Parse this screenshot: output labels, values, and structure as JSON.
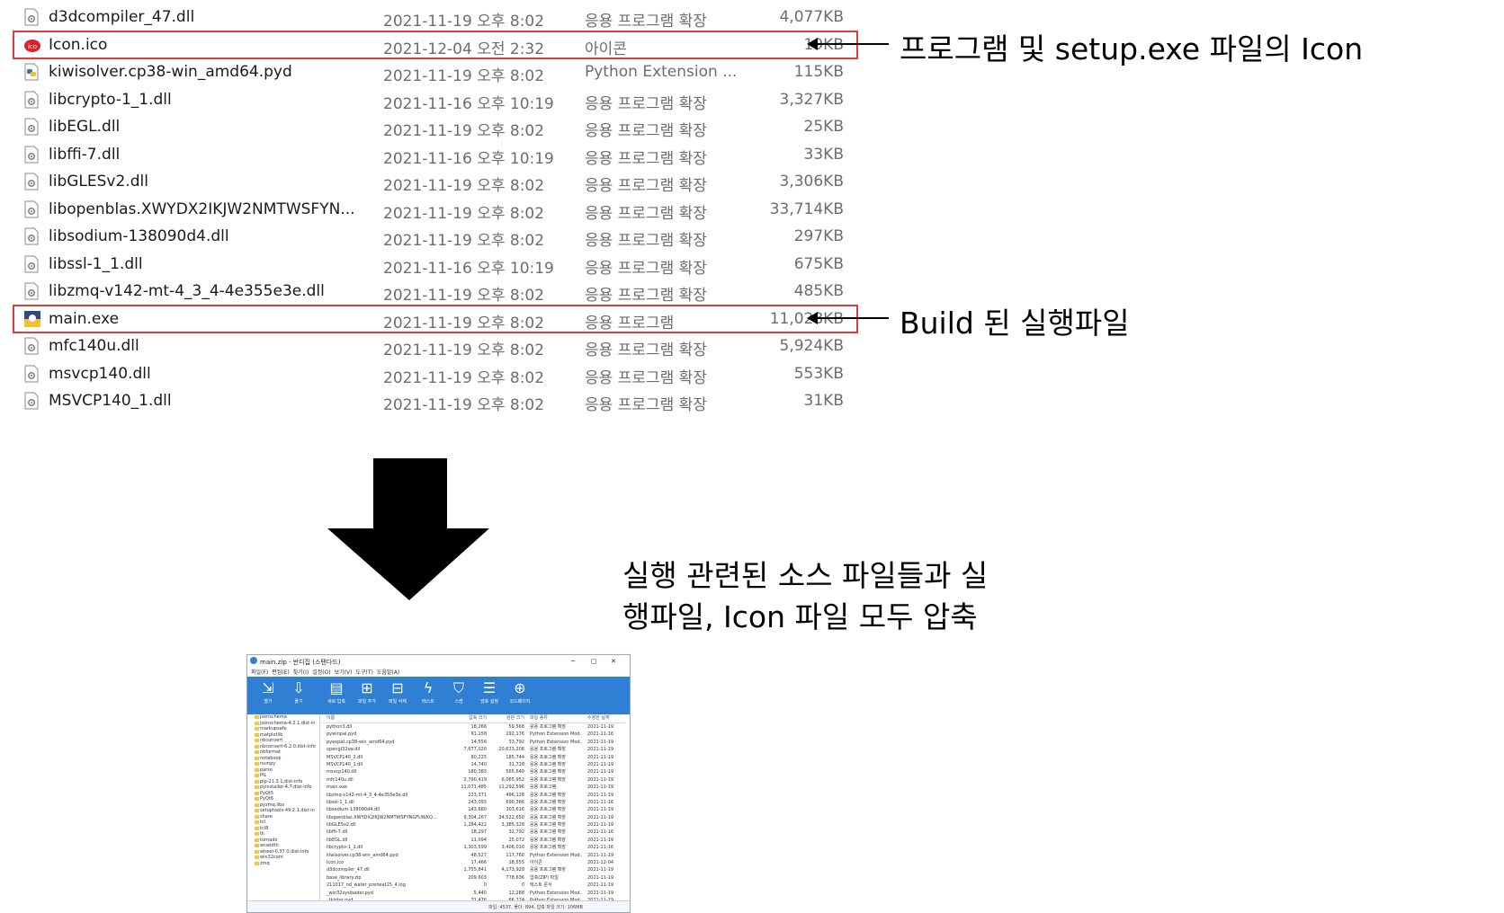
{
  "files": [
    {
      "name": "d3dcompiler_47.dll",
      "date": "2021-11-19 오후 8:02",
      "type": "응용 프로그램 확장",
      "size": "4,077KB",
      "icon": "dll-file-icon",
      "highlight": false
    },
    {
      "name": "Icon.ico",
      "date": "2021-12-04 오전 2:32",
      "type": "아이콘",
      "size": "19KB",
      "icon": "ico-file-icon",
      "highlight": true
    },
    {
      "name": "kiwisolver.cp38-win_amd64.pyd",
      "date": "2021-11-19 오후 8:02",
      "type": "Python Extension ...",
      "size": "115KB",
      "icon": "python-file-icon",
      "highlight": false
    },
    {
      "name": "libcrypto-1_1.dll",
      "date": "2021-11-16 오후 10:19",
      "type": "응용 프로그램 확장",
      "size": "3,327KB",
      "icon": "dll-file-icon",
      "highlight": false
    },
    {
      "name": "libEGL.dll",
      "date": "2021-11-19 오후 8:02",
      "type": "응용 프로그램 확장",
      "size": "25KB",
      "icon": "dll-file-icon",
      "highlight": false
    },
    {
      "name": "libffi-7.dll",
      "date": "2021-11-16 오후 10:19",
      "type": "응용 프로그램 확장",
      "size": "33KB",
      "icon": "dll-file-icon",
      "highlight": false
    },
    {
      "name": "libGLESv2.dll",
      "date": "2021-11-19 오후 8:02",
      "type": "응용 프로그램 확장",
      "size": "3,306KB",
      "icon": "dll-file-icon",
      "highlight": false
    },
    {
      "name": "libopenblas.XWYDX2IKJW2NMTWSFYN...",
      "date": "2021-11-19 오후 8:02",
      "type": "응용 프로그램 확장",
      "size": "33,714KB",
      "icon": "dll-file-icon",
      "highlight": false
    },
    {
      "name": "libsodium-138090d4.dll",
      "date": "2021-11-19 오후 8:02",
      "type": "응용 프로그램 확장",
      "size": "297KB",
      "icon": "dll-file-icon",
      "highlight": false
    },
    {
      "name": "libssl-1_1.dll",
      "date": "2021-11-16 오후 10:19",
      "type": "응용 프로그램 확장",
      "size": "675KB",
      "icon": "dll-file-icon",
      "highlight": false
    },
    {
      "name": "libzmq-v142-mt-4_3_4-4e355e3e.dll",
      "date": "2021-11-19 오후 8:02",
      "type": "응용 프로그램 확장",
      "size": "485KB",
      "icon": "dll-file-icon",
      "highlight": false
    },
    {
      "name": "main.exe",
      "date": "2021-11-19 오후 8:02",
      "type": "응용 프로그램",
      "size": "11,028KB",
      "icon": "exe-file-icon",
      "highlight": true
    },
    {
      "name": "mfc140u.dll",
      "date": "2021-11-19 오후 8:02",
      "type": "응용 프로그램 확장",
      "size": "5,924KB",
      "icon": "dll-file-icon",
      "highlight": false
    },
    {
      "name": "msvcp140.dll",
      "date": "2021-11-19 오후 8:02",
      "type": "응용 프로그램 확장",
      "size": "553KB",
      "icon": "dll-file-icon",
      "highlight": false
    },
    {
      "name": "MSVCP140_1.dll",
      "date": "2021-11-19 오후 8:02",
      "type": "응용 프로그램 확장",
      "size": "31KB",
      "icon": "dll-file-icon",
      "highlight": false
    }
  ],
  "annotations": {
    "icon_note": "프로그램 및 setup.exe 파일의 Icon",
    "build_note": "Build 된 실행파일",
    "zip_note_line1": "실행 관련된 소스 파일들과 실",
    "zip_note_line2": "행파일, Icon 파일 모두 압축"
  },
  "colors": {
    "highlight_border": "#e53a3a",
    "toolbar_bg": "#2f7fd4",
    "secondary_text": "#6d6d6d"
  },
  "mini_window": {
    "title": "main.zip - 반디집 (스탠다드)",
    "window_controls": [
      "─",
      "□",
      "✕"
    ],
    "menu": [
      "파일(F)",
      "편집(E)",
      "찾기(I)",
      "설정(O)",
      "보기(V)",
      "도구(T)",
      "도움말(A)"
    ],
    "toolbar": [
      {
        "label": "열기",
        "icon": "open-icon",
        "glyph": "⇲"
      },
      {
        "label": "풀기",
        "icon": "extract-icon",
        "glyph": "⇩"
      },
      {
        "label": "새로 압축",
        "icon": "new-archive-icon",
        "glyph": "▤"
      },
      {
        "label": "파일 추가",
        "icon": "add-file-icon",
        "glyph": "⊞"
      },
      {
        "label": "파일 삭제",
        "icon": "delete-file-icon",
        "glyph": "⊟"
      },
      {
        "label": "테스트",
        "icon": "test-icon",
        "glyph": "ϟ"
      },
      {
        "label": "스캔",
        "icon": "scan-icon",
        "glyph": "⛉"
      },
      {
        "label": "암호 설정",
        "icon": "password-icon",
        "glyph": "☰"
      },
      {
        "label": "코드페이지",
        "icon": "codepage-icon",
        "glyph": "⊕"
      }
    ],
    "folders": [
      "jsonschema",
      "jsonschema-4.2.1.dist-in",
      "markupsafe",
      "matplotlib",
      "nbconvert",
      "nbconvert-6.2.0.dist-info",
      "nbformat",
      "notebook",
      "numpy",
      "parso",
      "PIL",
      "pip-21.3.1.dist-info",
      "pyinstaller-4.7.dist-info",
      "PyQt5",
      "PyQt6",
      "pyzmq.libs",
      "setuptools-49.2.1.dist-in",
      "share",
      "tcl",
      "tcl8",
      "tk",
      "tornado",
      "wcwidth",
      "wheel-0.37.0.dist-info",
      "win32com",
      "zmq"
    ],
    "columns": [
      "이름",
      "압축 크기",
      "원본 크기",
      "파일 종류",
      "수정한 날짜"
    ],
    "rows": [
      [
        "python3.dll",
        "18,266",
        "59,568",
        "응용 프로그램 확장",
        "2021-11-19"
      ],
      [
        "pywinpal.pyd",
        "91,158",
        "192,176",
        "Python Extension Mod...",
        "2021-11-16"
      ],
      [
        "pyexpat.cp38-win_amd64.pyd",
        "14,556",
        "33,792",
        "Python Extension Mod...",
        "2021-11-19"
      ],
      [
        "opengl32sw.dll",
        "7,677,020",
        "20,633,208",
        "응용 프로그램 확장",
        "2021-11-19"
      ],
      [
        "MSVCP140_2.dll",
        "80,225",
        "185,744",
        "응용 프로그램 확장",
        "2021-11-19"
      ],
      [
        "MSVCP140_1.dll",
        "14,740",
        "31,728",
        "응용 프로그램 확장",
        "2021-11-19"
      ],
      [
        "msvcp140.dll",
        "180,383",
        "565,640",
        "응용 프로그램 확장",
        "2021-11-19"
      ],
      [
        "mfc140u.dll",
        "2,790,419",
        "6,065,952",
        "응용 프로그램 확장",
        "2021-11-19"
      ],
      [
        "main.exe",
        "11,071,485",
        "11,292,596",
        "응용 프로그램",
        "2021-11-19"
      ],
      [
        "libzmq-v142-mt-4_3_4-4e355e3e.dll",
        "223,371",
        "496,128",
        "응용 프로그램 확장",
        "2021-11-19"
      ],
      [
        "libssl-1_1.dll",
        "243,093",
        "690,366",
        "응용 프로그램 확장",
        "2021-11-16"
      ],
      [
        "libsodium-138090d4.dll",
        "143,660",
        "303,616",
        "응용 프로그램 확장",
        "2021-11-19"
      ],
      [
        "libopenblas.XWYDX2IKJW2NMTWSFYNGFUWKQ...",
        "9,304,267",
        "34,522,650",
        "응용 프로그램 확장",
        "2021-11-19"
      ],
      [
        "libGLESv2.dll",
        "1,284,422",
        "3,385,328",
        "응용 프로그램 확장",
        "2021-11-19"
      ],
      [
        "libffi-7.dll",
        "18,297",
        "32,792",
        "응용 프로그램 확장",
        "2021-11-16"
      ],
      [
        "libEGL.dll",
        "11,094",
        "25,072",
        "응용 프로그램 확장",
        "2021-11-19"
      ],
      [
        "libcrypto-1_1.dll",
        "1,303,599",
        "3,406,016",
        "응용 프로그램 확장",
        "2021-11-16"
      ],
      [
        "kiwisolver.cp38-win_amd64.pyd",
        "48,527",
        "117,760",
        "Python Extension Mod...",
        "2021-11-19"
      ],
      [
        "Icon.ico",
        "17,466",
        "18,555",
        "아이콘",
        "2021-12-04"
      ],
      [
        "d3dcompiler_47.dll",
        "1,755,841",
        "4,173,928",
        "응용 프로그램 확장",
        "2021-11-19"
      ],
      [
        "base_library.zip",
        "209,603",
        "778,636",
        "압축(ZIP) 파일",
        "2021-11-19"
      ],
      [
        "211017_nd_water_preheat25_4.log",
        "0",
        "0",
        "텍스트 문서",
        "2021-11-19"
      ],
      [
        "_win32sysloader.pyd",
        "5,440",
        "12,288",
        "Python Extension Mod...",
        "2021-11-19"
      ],
      [
        "_tkinter.pyd",
        "31,476",
        "66,224",
        "Python Extension Mod...",
        "2021-11-19"
      ]
    ],
    "status_text": "파일: 4537, 폴더: 894, 압축 파일 크기: 106MB"
  }
}
